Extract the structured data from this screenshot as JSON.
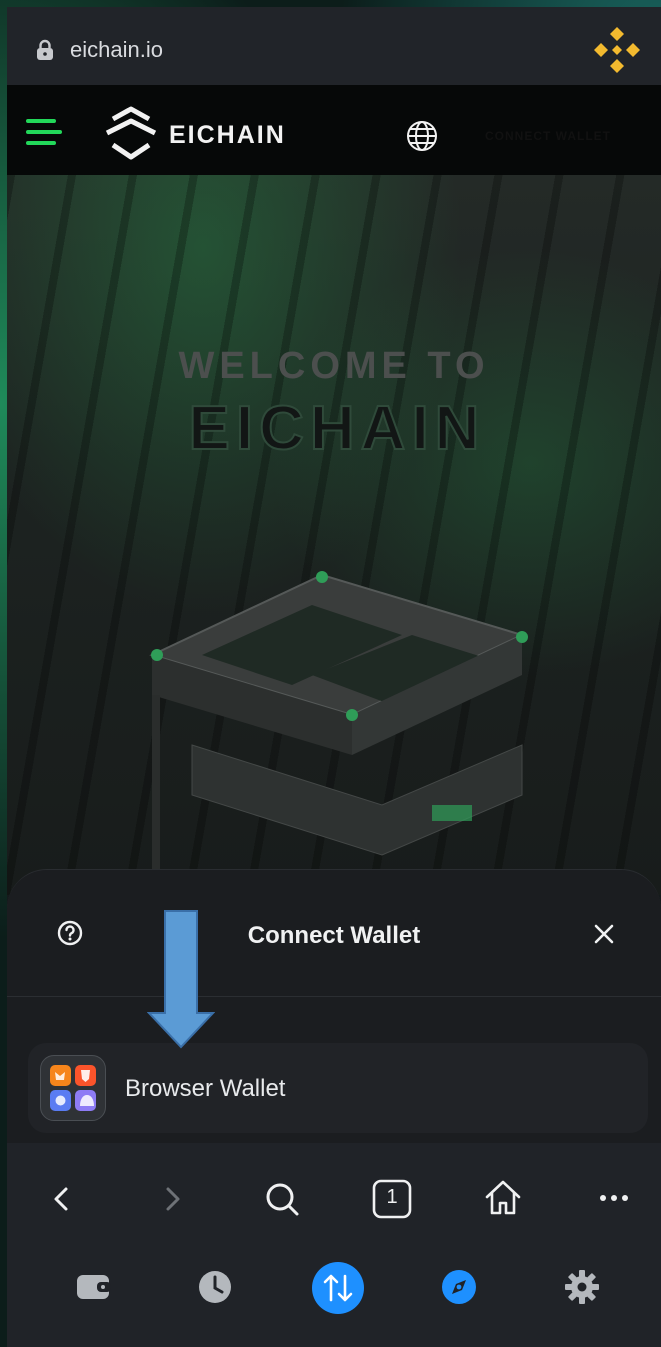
{
  "browser": {
    "url": "eichain.io",
    "icons": [
      "lock-icon",
      "binance-icon"
    ]
  },
  "site": {
    "logo_text": "EICHAIN",
    "hero_line1": "WELCOME TO",
    "hero_line2": "EICHAIN",
    "connect_label": "CONNECT WALLET",
    "accent": "#22d85a"
  },
  "sheet": {
    "title": "Connect Wallet",
    "wallets": [
      {
        "label": "Browser Wallet"
      }
    ]
  },
  "toolbar": {
    "tab_count": "1",
    "nav_icons": [
      "back-icon",
      "forward-icon",
      "search-icon",
      "tabs-icon",
      "home-icon",
      "more-icon"
    ],
    "bottom_icons": [
      "wallet-icon",
      "history-icon",
      "swap-icon",
      "discover-icon",
      "settings-icon"
    ],
    "accent": "#1e90ff"
  }
}
